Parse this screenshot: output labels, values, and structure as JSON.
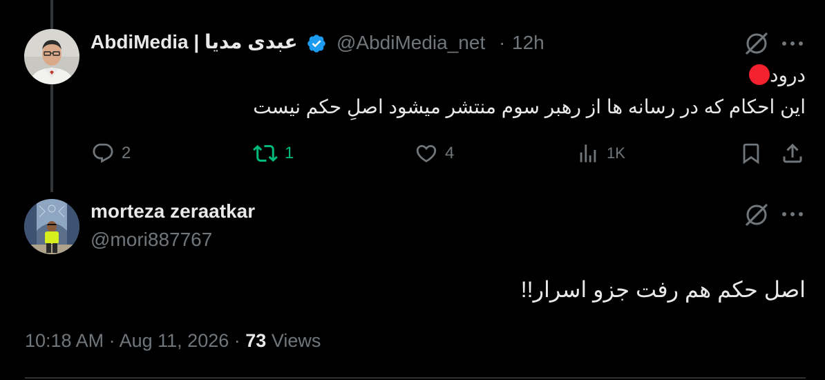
{
  "parent_tweet": {
    "author_name": "AbdiMedia | عبدی مدیا",
    "handle": "@AbdiMedia_net",
    "separator": "·",
    "time": "12h",
    "greeting_text": "درود",
    "body_text": "این احکام که در رسانه ها از رهبر سوم منتشر میشود اصلِ حکم نیست",
    "replies": "2",
    "reposts": "1",
    "likes": "4",
    "views": "1K"
  },
  "reply_tweet": {
    "author_name": "morteza zeraatkar",
    "handle": "@mori887767",
    "body_text": "اصل حکم هم رفت جزو اسرار!!",
    "time": "10:18 AM",
    "date": "Aug 11, 2026",
    "separator": "·",
    "view_count": "73",
    "views_label": "Views"
  },
  "colors": {
    "background": "#000000",
    "text": "#e7e9ea",
    "muted": "#71767b",
    "verified": "#1d9bf0",
    "repost_active": "#00ba7c",
    "red_dot": "#f4212e"
  },
  "icons": [
    "grok-icon",
    "more-icon",
    "reply-icon",
    "repost-icon",
    "like-icon",
    "views-icon",
    "bookmark-icon",
    "share-icon",
    "verified-badge-icon",
    "red-circle-emoji"
  ]
}
